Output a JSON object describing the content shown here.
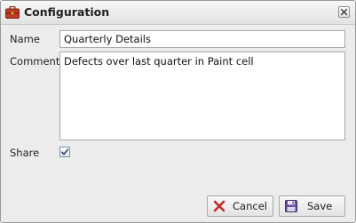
{
  "window": {
    "title": "Configuration",
    "icon": "toolbox-icon",
    "close_icon": "close-icon"
  },
  "form": {
    "name": {
      "label": "Name",
      "value": "Quarterly Details"
    },
    "comments": {
      "label": "Comments",
      "value": "Defects over last quarter in Paint cell"
    },
    "share": {
      "label": "Share",
      "checked": true
    }
  },
  "buttons": {
    "cancel": {
      "label": "Cancel",
      "icon": "cancel-x-icon"
    },
    "save": {
      "label": "Save",
      "icon": "floppy-disk-icon"
    }
  },
  "colors": {
    "dialog_background": "#ececec",
    "cancel_icon": "#c62828",
    "save_icon": "#6a4fa3",
    "title_icon": "#c0392b"
  }
}
